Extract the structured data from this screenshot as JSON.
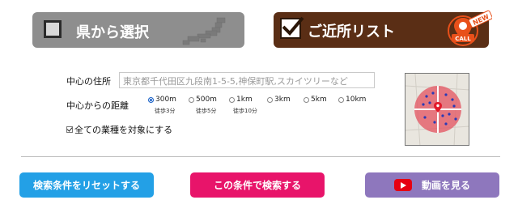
{
  "tabs": {
    "prefecture": {
      "label": "県から選択",
      "selected": false,
      "icon": "japan-map-icon"
    },
    "nearby": {
      "label": "ご近所リスト",
      "selected": true,
      "badge_text": "CALL",
      "badge_ribbon": "NEW",
      "icon": "location-pin-icon"
    }
  },
  "form": {
    "address_label": "中心の住所",
    "address_placeholder": "東京都千代田区九段南1-5-5,神保町駅,スカイツリーなど",
    "distance_label": "中心からの距離",
    "distance_options": [
      {
        "label": "300m",
        "walk": "徒歩3分",
        "checked": true
      },
      {
        "label": "500m",
        "walk": "徒歩5分",
        "checked": false
      },
      {
        "label": "1km",
        "walk": "徒歩10分",
        "checked": false
      },
      {
        "label": "3km",
        "walk": "",
        "checked": false
      },
      {
        "label": "5km",
        "walk": "",
        "checked": false
      },
      {
        "label": "10km",
        "walk": "",
        "checked": false
      }
    ],
    "all_industries_label": "全ての業種を対象にする",
    "all_industries_checked": true
  },
  "buttons": {
    "reset": "検索条件をリセットする",
    "search": "この条件で検索する",
    "video": "動画を見る"
  },
  "colors": {
    "reset": "#23a0e6",
    "search": "#e8146a",
    "video": "#8e77bd",
    "nearby_tab": "#5a2e15",
    "pref_tab": "#8e8e8e"
  }
}
